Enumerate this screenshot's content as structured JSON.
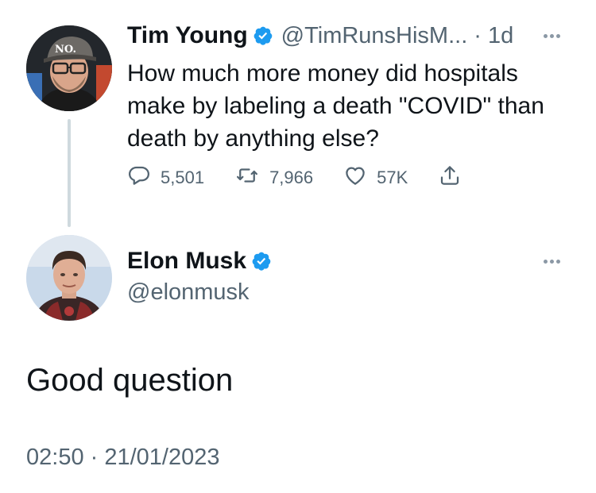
{
  "reply_tweet": {
    "name": "Tim Young",
    "handle": "@TimRunsHisM...",
    "separator": "·",
    "time_ago": "1d",
    "text": "How much more money did hospitals make by labeling a death \"COVID\" than death by anything else?",
    "verified_icon": "verified-badge-icon",
    "avatar_cap_text": "NO.",
    "actions": {
      "replies": "5,501",
      "retweets": "7,966",
      "likes": "57K"
    }
  },
  "main_tweet": {
    "name": "Elon Musk",
    "handle": "@elonmusk",
    "verified_icon": "verified-badge-icon",
    "text": "Good question",
    "timestamp": "02:50 · 21/01/2023"
  },
  "colors": {
    "verified_blue": "#1d9bf0",
    "muted_text": "#536471",
    "thread_line": "#cfd9de"
  }
}
